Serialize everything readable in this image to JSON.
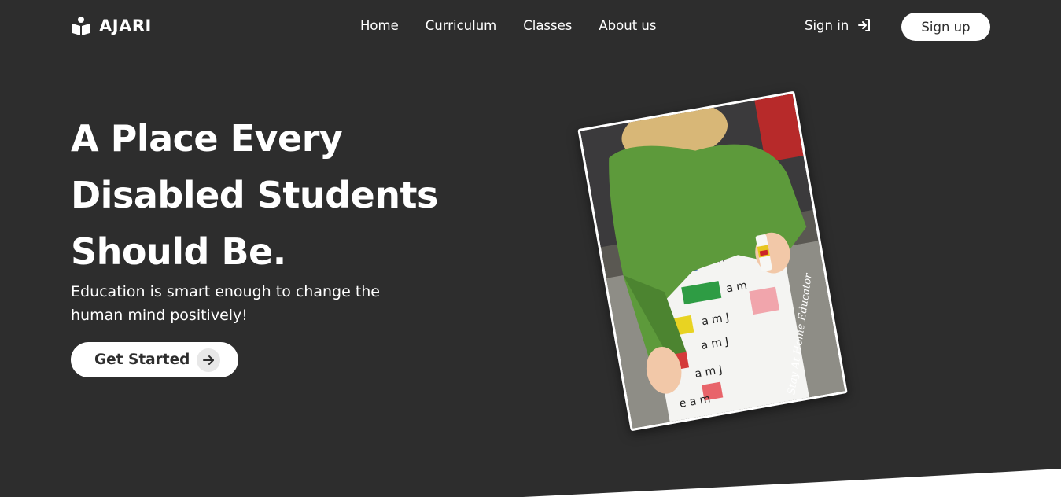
{
  "brand": {
    "name": "AJARI",
    "icon": "book-reader-icon"
  },
  "nav": {
    "links": [
      "Home",
      "Curriculum",
      "Classes",
      "About us"
    ],
    "signin_label": "Sign in",
    "signup_label": "Sign up"
  },
  "hero": {
    "title_lines": [
      "A Place Every",
      "Disabled Students",
      "Should Be."
    ],
    "subtitle": "Education is smart enough to change the human mind positively!",
    "cta_label": "Get Started",
    "photo_caption": "Stay At Home Educator"
  },
  "colors": {
    "background": "#2d2d2d",
    "text": "#ffffff",
    "button_bg": "#ffffff",
    "button_text": "#2d2d2d"
  }
}
